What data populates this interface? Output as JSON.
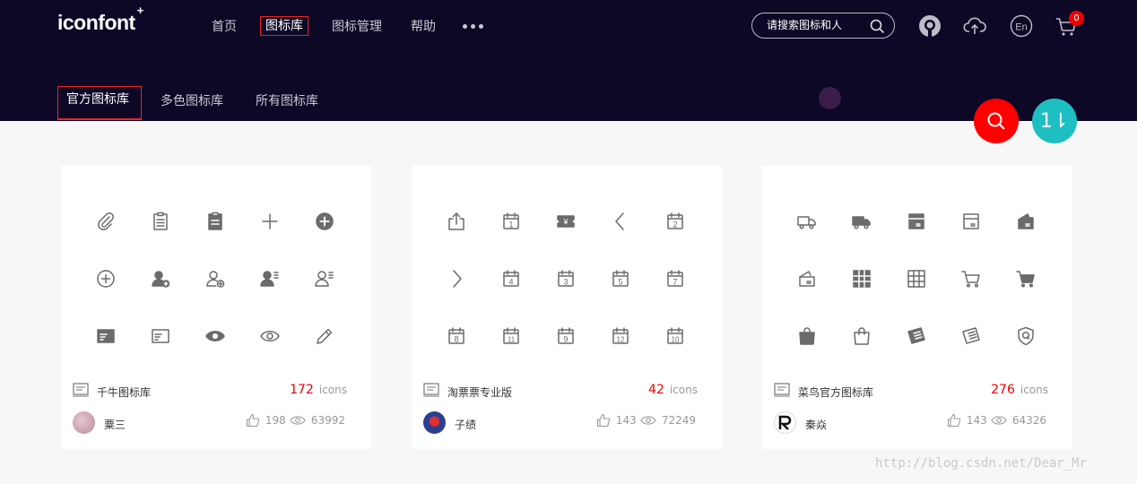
{
  "app": {
    "logo": "iconfont",
    "logo_mark": "+"
  },
  "nav": {
    "items": [
      "首页",
      "图标库",
      "图标管理",
      "帮助"
    ],
    "active_index": 1
  },
  "search": {
    "placeholder": "请搜索图标和人"
  },
  "cart": {
    "count": "0"
  },
  "subnav": {
    "items": [
      "官方图标库",
      "多色图标库",
      "所有图标库"
    ],
    "active_index": 0
  },
  "fab": {
    "sort_label": "1⇂"
  },
  "colors": {
    "header_bg": "#0c0826",
    "accent_red": "#ff0000",
    "accent_teal": "#1dbfc2",
    "count_red": "#e00000"
  },
  "cards": [
    {
      "library_name": "千牛图标库",
      "icon_count": "172",
      "icon_unit": "icons",
      "author": "粟三",
      "likes": "198",
      "views": "63992",
      "icons": [
        "paperclip-icon",
        "clipboard-list-icon",
        "clipboard-filled-icon",
        "plus-icon",
        "plus-circle-filled-icon",
        "plus-circle-outline-icon",
        "user-add-filled-icon",
        "user-add-outline-icon",
        "user-list-filled-icon",
        "user-list-outline-icon",
        "card-filled-icon",
        "card-outline-icon",
        "eye-filled-icon",
        "eye-outline-icon",
        "pencil-icon"
      ]
    },
    {
      "library_name": "淘票票专业版",
      "icon_count": "42",
      "icon_unit": "icons",
      "author": "子绩",
      "likes": "143",
      "views": "72249",
      "icons": [
        "share-icon",
        "calendar-1-icon",
        "ticket-yen-icon",
        "chevron-left-icon",
        "calendar-2-icon",
        "chevron-right-icon",
        "calendar-4-icon",
        "calendar-3-icon",
        "calendar-5-icon",
        "calendar-7-icon",
        "calendar-8-icon",
        "calendar-11-icon",
        "calendar-9-icon",
        "calendar-12-icon",
        "calendar-10-icon"
      ],
      "calendar_numbers": {
        "1": "1",
        "4": "2",
        "6": "4",
        "7": "3",
        "8": "5",
        "9": "7",
        "10": "8",
        "11": "11",
        "12": "9",
        "13": "12",
        "14": "10"
      },
      "ticket_symbol": "¥"
    },
    {
      "library_name": "菜鸟官方图标库",
      "icon_count": "276",
      "icon_unit": "icons",
      "author": "秦焱",
      "likes": "143",
      "views": "64326",
      "icons": [
        "truck-outline-icon",
        "truck-filled-icon",
        "box-filled-icon",
        "box-outline-icon",
        "package-open-filled-icon",
        "package-open-outline-icon",
        "grid-filled-icon",
        "grid-outline-icon",
        "cart-outline-icon",
        "cart-filled-icon",
        "bag-filled-icon",
        "bag-outline-icon",
        "book-filled-icon",
        "book-outline-icon",
        "shield-q-icon"
      ]
    }
  ],
  "watermark": "http://blog.csdn.net/Dear_Mr"
}
